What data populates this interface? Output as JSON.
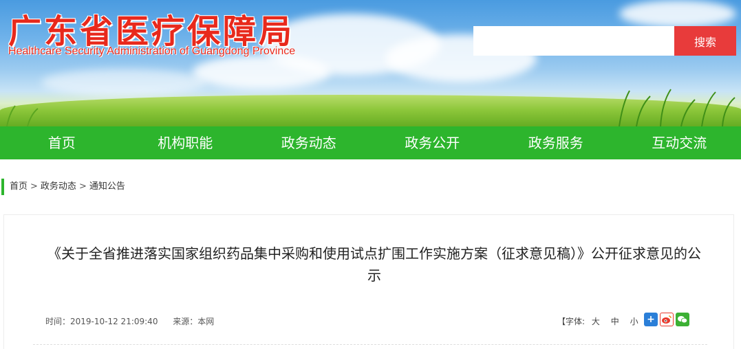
{
  "header": {
    "title": "广东省医疗保障局",
    "subtitle": "Healthcare Security Administration of Guangdong Province",
    "search_placeholder": "",
    "search_button": "搜索"
  },
  "nav": {
    "items": [
      {
        "label": "首页"
      },
      {
        "label": "机构职能"
      },
      {
        "label": "政务动态"
      },
      {
        "label": "政务公开"
      },
      {
        "label": "政务服务"
      },
      {
        "label": "互动交流"
      }
    ]
  },
  "breadcrumb": {
    "items": [
      "首页",
      "政务动态",
      "通知公告"
    ],
    "separator": ">"
  },
  "article": {
    "title": "《关于全省推进落实国家组织药品集中采购和使用试点扩围工作实施方案（征求意见稿）》公开征求意见的公示",
    "time": "时间：2019-10-12 21:09:40",
    "source": "来源：本网",
    "font_label": "【字体:",
    "font_large": "大",
    "font_medium": "中",
    "font_small": "小",
    "font_close": "】"
  },
  "share": {
    "icons": [
      "plus-share-icon",
      "weibo-icon",
      "wechat-icon"
    ],
    "colors": [
      "#2b7fd8",
      "#e8392d",
      "#3cb034"
    ]
  },
  "colors": {
    "nav_bg": "#2db52d",
    "brand_red": "#e8291c",
    "search_button": "#e83b3b"
  }
}
